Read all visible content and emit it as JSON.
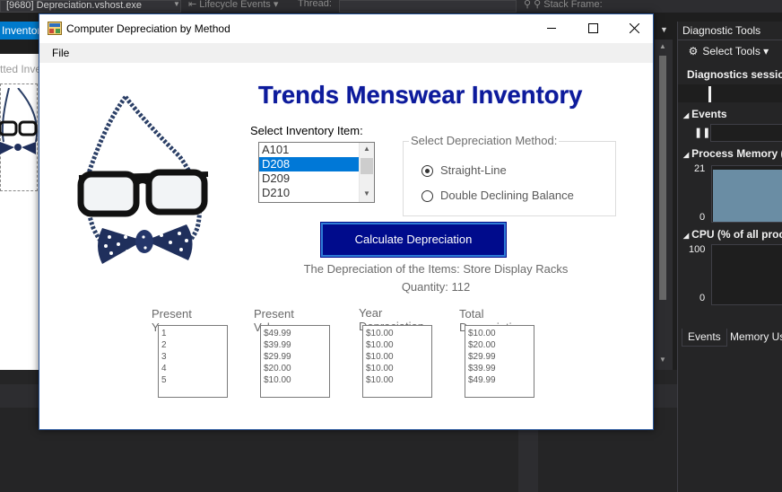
{
  "vs": {
    "process": "[9680] Depreciation.vshost.exe",
    "lifecycle": "Lifecycle Events",
    "thread_label": "Thread:",
    "stack_frame": "Stack Frame:",
    "left_tab": "Inventor",
    "left_doc_header": "tted Inve",
    "diagnostics": {
      "title": "Diagnostic Tools",
      "select_tools": "Select Tools",
      "session": "Diagnostics session",
      "events": "Events",
      "process_memory": "Process Memory (",
      "mem_max": "21",
      "mem_min": "0",
      "cpu": "CPU (% of all proc",
      "cpu_max": "100",
      "cpu_min": "0",
      "tab_events": "Events",
      "tab_memory": "Memory Us"
    }
  },
  "window": {
    "title": "Computer Depreciation by Method",
    "menu": [
      "File"
    ]
  },
  "form": {
    "heading": "Trends Menswear Inventory",
    "select_item_label": "Select Inventory Item:",
    "items": [
      "A101",
      "D208",
      "D209",
      "D210"
    ],
    "selected_item": "D208",
    "method_group_label": "Select Depreciation Method:",
    "methods": [
      {
        "label": "Straight-Line",
        "checked": true
      },
      {
        "label": "Double Declining Balance",
        "checked": false
      }
    ],
    "calc_button": "Calculate Depreciation",
    "result_line": "The Depreciation of the Items: Store Display Racks",
    "quantity_line": "Quantity: 112",
    "columns": [
      {
        "header": [
          "Present",
          "Year"
        ],
        "values": [
          "1",
          "2",
          "3",
          "4",
          "5"
        ]
      },
      {
        "header": [
          "Present",
          "Value"
        ],
        "values": [
          "$49.99",
          "$39.99",
          "$29.99",
          "$20.00",
          "$10.00"
        ]
      },
      {
        "header": [
          "Year",
          "Depreciation"
        ],
        "values": [
          "$10.00",
          "$10.00",
          "$10.00",
          "$10.00",
          "$10.00"
        ]
      },
      {
        "header": [
          "Total",
          "Depreciation"
        ],
        "values": [
          "$10.00",
          "$20.00",
          "$29.99",
          "$39.99",
          "$49.99"
        ]
      }
    ]
  },
  "colors": {
    "heading": "#0d1b9c",
    "button_bg": "#000b8c",
    "selection": "#0078d7",
    "vs_accent": "#007acc"
  },
  "icons": [
    "app-icon",
    "minimize-icon",
    "maximize-icon",
    "close-icon",
    "gear-icon",
    "pause-icon",
    "chevron-down-icon"
  ]
}
